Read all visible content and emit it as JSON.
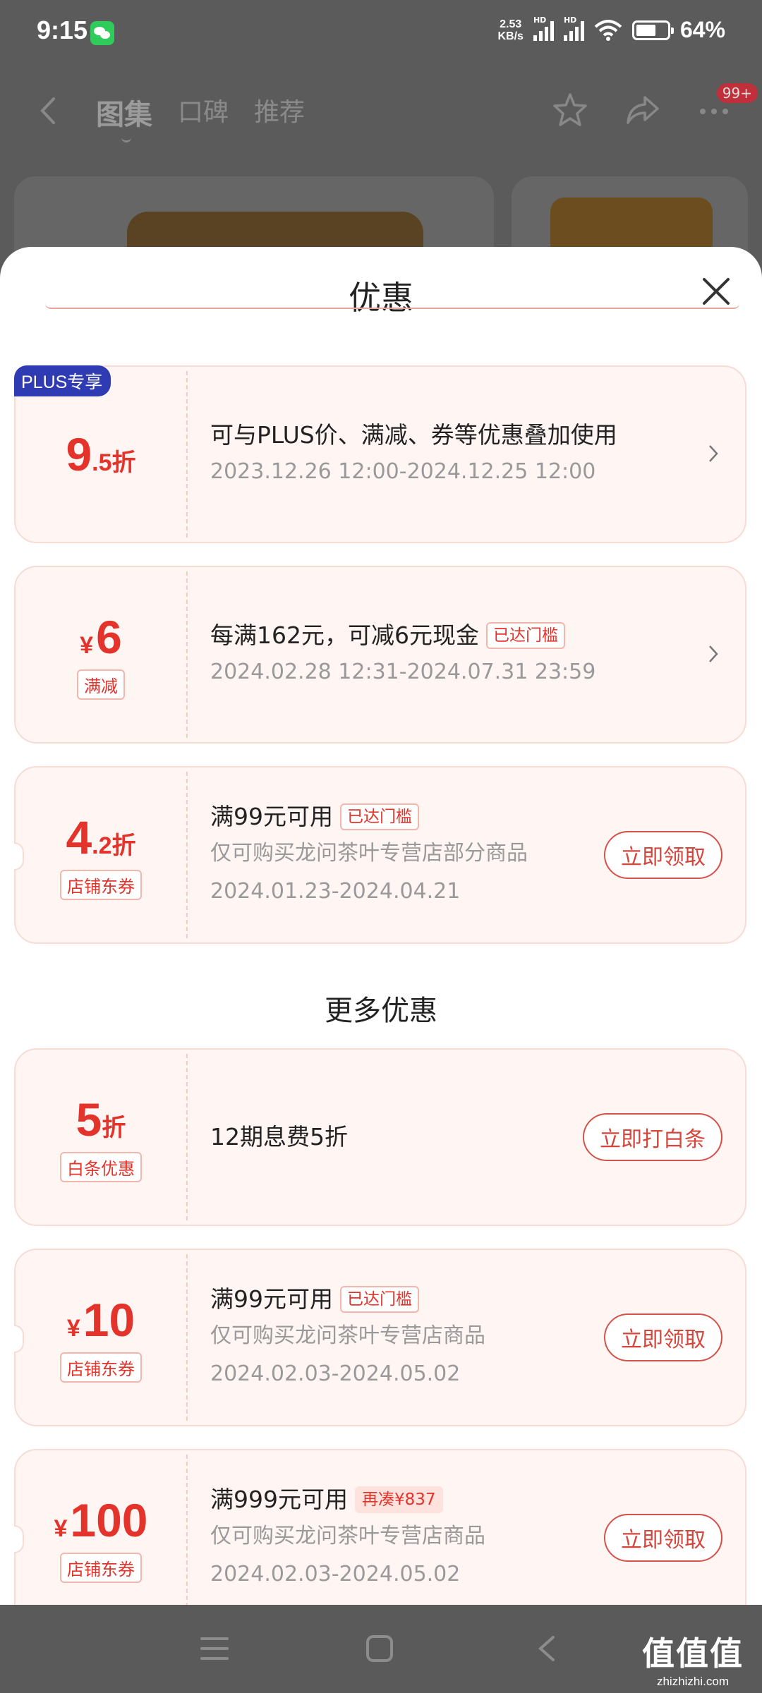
{
  "status_bar": {
    "time": "9:15",
    "net_speed_value": "2.53",
    "net_speed_unit": "KB/s",
    "signal_label": "HD",
    "battery": "64%",
    "battery_level": 0.64,
    "app_icon": "wechat-icon"
  },
  "header": {
    "tabs": [
      "图集",
      "口碑",
      "推荐"
    ],
    "active_tab": 0,
    "badge": "99+",
    "icons": [
      "back-icon",
      "star-icon",
      "share-icon",
      "more-icon"
    ]
  },
  "sheet": {
    "title": "优惠",
    "close_icon": "close-icon",
    "offers": [
      {
        "plus_tag": "PLUS专享",
        "value_big": "9",
        "value_small": ".5折",
        "text": "可与PLUS价、满减、券等优惠叠加使用",
        "date": "2023.12.26 12:00-2024.12.25 12:00"
      },
      {
        "currency": "¥",
        "value_big": "6",
        "tag": "满减",
        "text": "每满162元，可减6元现金",
        "status": "已达门槛",
        "date": "2024.02.28 12:31-2024.07.31 23:59"
      },
      {
        "value_big": "4",
        "value_small": ".2折",
        "tag": "店铺东券",
        "text": "满99元可用",
        "status": "已达门槛",
        "desc": "仅可购买龙问茶叶专营店部分商品",
        "date": "2024.01.23-2024.04.21",
        "button": "立即领取"
      }
    ],
    "more_title": "更多优惠",
    "more_offers": [
      {
        "value_big": "5",
        "value_small": "折",
        "tag": "白条优惠",
        "text": "12期息费5折",
        "button": "立即打白条"
      },
      {
        "currency": "¥",
        "value_big": "10",
        "tag": "店铺东券",
        "text": "满99元可用",
        "status": "已达门槛",
        "desc": "仅可购买龙问茶叶专营店商品",
        "date": "2024.02.03-2024.05.02",
        "button": "立即领取"
      },
      {
        "currency": "¥",
        "value_big": "100",
        "tag": "店铺东券",
        "text": "满999元可用",
        "status": "再凑¥837",
        "desc": "仅可购买龙问茶叶专营店商品",
        "date": "2024.02.03-2024.05.02",
        "button": "立即领取"
      }
    ]
  },
  "nav": {
    "icons": [
      "menu-icon",
      "home-icon",
      "back-nav-icon"
    ]
  },
  "watermark": {
    "title": "值值值",
    "url": "zhizhizhi.com"
  },
  "colors": {
    "accent": "#e4332a",
    "plus": "#2f3bb2",
    "card_bg": "#fff6f4"
  }
}
